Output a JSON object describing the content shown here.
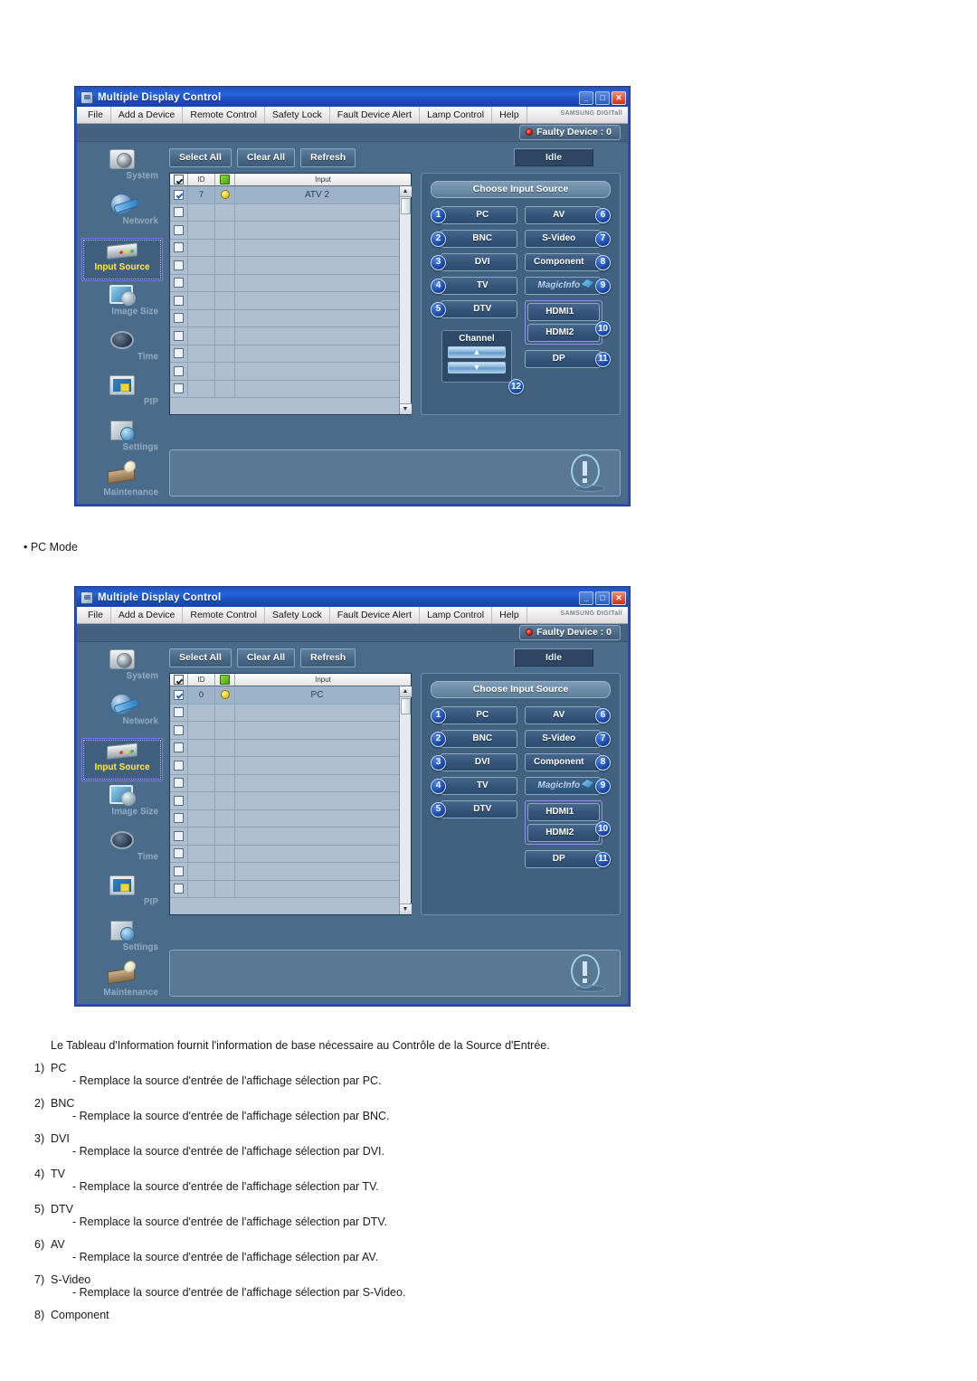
{
  "windows": [
    {
      "title": "Multiple Display Control",
      "menu": [
        "File",
        "Add a Device",
        "Remote Control",
        "Safety Lock",
        "Fault Device Alert",
        "Lamp Control",
        "Help"
      ],
      "brand": "SAMSUNG DIGITall",
      "faulty_label": "Faulty Device : 0",
      "window_buttons": {
        "minimize": "_",
        "maximize": "□",
        "close": "✕"
      },
      "sidebar": [
        {
          "label": "System",
          "icon": "camera-icon"
        },
        {
          "label": "Network",
          "icon": "globe-icon"
        },
        {
          "label": "Input Source",
          "icon": "input-device-icon",
          "active": true
        },
        {
          "label": "Image Size",
          "icon": "monitor-icon"
        },
        {
          "label": "Time",
          "icon": "clock-icon"
        },
        {
          "label": "PIP",
          "icon": "pip-icon"
        },
        {
          "label": "Settings",
          "icon": "settings-cube-icon"
        },
        {
          "label": "Maintenance",
          "icon": "maintenance-icon"
        }
      ],
      "toolbar": {
        "select_all": "Select All",
        "clear_all": "Clear All",
        "refresh": "Refresh",
        "status": "Idle"
      },
      "table": {
        "headers": {
          "check": "check-icon",
          "id": "ID",
          "status": "status-icon",
          "input": "Input"
        },
        "rows": [
          {
            "checked": true,
            "id": "7",
            "status": "yellow",
            "input": "ATV 2"
          },
          {
            "checked": false,
            "id": "",
            "status": "",
            "input": ""
          },
          {
            "checked": false,
            "id": "",
            "status": "",
            "input": ""
          },
          {
            "checked": false,
            "id": "",
            "status": "",
            "input": ""
          },
          {
            "checked": false,
            "id": "",
            "status": "",
            "input": ""
          },
          {
            "checked": false,
            "id": "",
            "status": "",
            "input": ""
          },
          {
            "checked": false,
            "id": "",
            "status": "",
            "input": ""
          },
          {
            "checked": false,
            "id": "",
            "status": "",
            "input": ""
          },
          {
            "checked": false,
            "id": "",
            "status": "",
            "input": ""
          },
          {
            "checked": false,
            "id": "",
            "status": "",
            "input": ""
          },
          {
            "checked": false,
            "id": "",
            "status": "",
            "input": ""
          },
          {
            "checked": false,
            "id": "",
            "status": "",
            "input": ""
          }
        ],
        "scroll_up": "▲",
        "scroll_down": "▼"
      },
      "source_panel": {
        "title": "Choose Input Source",
        "left": [
          {
            "n": "1",
            "label": "PC"
          },
          {
            "n": "2",
            "label": "BNC"
          },
          {
            "n": "3",
            "label": "DVI"
          },
          {
            "n": "4",
            "label": "TV"
          },
          {
            "n": "5",
            "label": "DTV"
          }
        ],
        "right": [
          {
            "n": "6",
            "label": "AV"
          },
          {
            "n": "7",
            "label": "S-Video"
          },
          {
            "n": "8",
            "label": "Component"
          },
          {
            "n": "9",
            "label": "MagicInfo"
          }
        ],
        "hdmi": {
          "n": "10",
          "items": [
            "HDMI1",
            "HDMI2"
          ]
        },
        "dp": {
          "n": "11",
          "label": "DP"
        },
        "channel": {
          "n": "12",
          "title": "Channel",
          "up": "▲",
          "down": "▼",
          "visible": true
        }
      }
    },
    {
      "title": "Multiple Display Control",
      "menu": [
        "File",
        "Add a Device",
        "Remote Control",
        "Safety Lock",
        "Fault Device Alert",
        "Lamp Control",
        "Help"
      ],
      "brand": "SAMSUNG DIGITall",
      "faulty_label": "Faulty Device : 0",
      "window_buttons": {
        "minimize": "_",
        "maximize": "□",
        "close": "✕"
      },
      "sidebar": [
        {
          "label": "System",
          "icon": "camera-icon"
        },
        {
          "label": "Network",
          "icon": "globe-icon"
        },
        {
          "label": "Input Source",
          "icon": "input-device-icon",
          "active": true
        },
        {
          "label": "Image Size",
          "icon": "monitor-icon"
        },
        {
          "label": "Time",
          "icon": "clock-icon"
        },
        {
          "label": "PIP",
          "icon": "pip-icon"
        },
        {
          "label": "Settings",
          "icon": "settings-cube-icon"
        },
        {
          "label": "Maintenance",
          "icon": "maintenance-icon"
        }
      ],
      "toolbar": {
        "select_all": "Select All",
        "clear_all": "Clear All",
        "refresh": "Refresh",
        "status": "Idle"
      },
      "table": {
        "headers": {
          "check": "check-icon",
          "id": "ID",
          "status": "status-icon",
          "input": "Input"
        },
        "rows": [
          {
            "checked": true,
            "id": "0",
            "status": "yellow",
            "input": "PC"
          },
          {
            "checked": false,
            "id": "",
            "status": "",
            "input": ""
          },
          {
            "checked": false,
            "id": "",
            "status": "",
            "input": ""
          },
          {
            "checked": false,
            "id": "",
            "status": "",
            "input": ""
          },
          {
            "checked": false,
            "id": "",
            "status": "",
            "input": ""
          },
          {
            "checked": false,
            "id": "",
            "status": "",
            "input": ""
          },
          {
            "checked": false,
            "id": "",
            "status": "",
            "input": ""
          },
          {
            "checked": false,
            "id": "",
            "status": "",
            "input": ""
          },
          {
            "checked": false,
            "id": "",
            "status": "",
            "input": ""
          },
          {
            "checked": false,
            "id": "",
            "status": "",
            "input": ""
          },
          {
            "checked": false,
            "id": "",
            "status": "",
            "input": ""
          },
          {
            "checked": false,
            "id": "",
            "status": "",
            "input": ""
          }
        ],
        "scroll_up": "▲",
        "scroll_down": "▼"
      },
      "source_panel": {
        "title": "Choose Input Source",
        "left": [
          {
            "n": "1",
            "label": "PC"
          },
          {
            "n": "2",
            "label": "BNC"
          },
          {
            "n": "3",
            "label": "DVI"
          },
          {
            "n": "4",
            "label": "TV"
          },
          {
            "n": "5",
            "label": "DTV"
          }
        ],
        "right": [
          {
            "n": "6",
            "label": "AV"
          },
          {
            "n": "7",
            "label": "S-Video"
          },
          {
            "n": "8",
            "label": "Component"
          },
          {
            "n": "9",
            "label": "MagicInfo"
          }
        ],
        "hdmi": {
          "n": "10",
          "items": [
            "HDMI1",
            "HDMI2"
          ]
        },
        "dp": {
          "n": "11",
          "label": "DP"
        },
        "channel": {
          "visible": false
        }
      }
    }
  ],
  "doc": {
    "pc_mode_bullet": "• PC Mode",
    "intro": "Le Tableau d'Information fournit l'information de base nécessaire au Contrôle de la Source d'Entrée.",
    "items": [
      {
        "num": "1)",
        "term": "PC",
        "desc": "- Remplace la source d'entrée de l'affichage sélection par PC."
      },
      {
        "num": "2)",
        "term": "BNC",
        "desc": "- Remplace la source d'entrée de l'affichage sélection par BNC."
      },
      {
        "num": "3)",
        "term": "DVI",
        "desc": "- Remplace la source d'entrée de l'affichage sélection par DVI."
      },
      {
        "num": "4)",
        "term": "TV",
        "desc": "- Remplace la source d'entrée de l'affichage sélection par TV."
      },
      {
        "num": "5)",
        "term": "DTV",
        "desc": "- Remplace la source d'entrée de l'affichage sélection par DTV."
      },
      {
        "num": "6)",
        "term": "AV",
        "desc": "- Remplace la source d'entrée de l'affichage sélection par AV."
      },
      {
        "num": "7)",
        "term": "S-Video",
        "desc": "- Remplace la source d'entrée de l'affichage sélection par S-Video."
      },
      {
        "num": "8)",
        "term": "Component",
        "desc": ""
      }
    ]
  },
  "colors": {
    "window_bg": "#4a6b8a",
    "title_blue": "#1f57c8",
    "accent_yellow": "#ffe24a",
    "badge_blue": "#133f9c",
    "led_red": "#c31408"
  }
}
